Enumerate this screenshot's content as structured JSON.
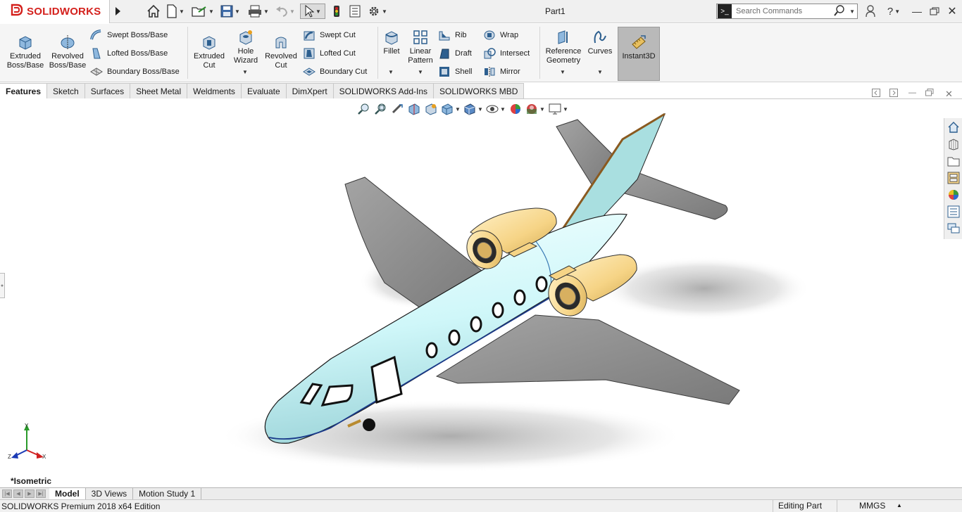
{
  "app": {
    "brand_prefix": "3DS",
    "brand_name": "SOLIDWORKS",
    "document_title": "Part1"
  },
  "search": {
    "placeholder": "Search Commands"
  },
  "quick_access": [
    "home-icon",
    "new-icon",
    "open-icon",
    "save-icon",
    "print-icon",
    "undo-icon",
    "select-icon",
    "rebuild-icon",
    "file-properties-icon",
    "options-icon"
  ],
  "ribbon": {
    "extruded_boss": "Extruded\nBoss/Base",
    "revolved_boss": "Revolved\nBoss/Base",
    "swept_boss": "Swept Boss/Base",
    "lofted_boss": "Lofted Boss/Base",
    "boundary_boss": "Boundary Boss/Base",
    "extruded_cut": "Extruded\nCut",
    "hole_wizard": "Hole\nWizard",
    "revolved_cut": "Revolved\nCut",
    "swept_cut": "Swept Cut",
    "lofted_cut": "Lofted Cut",
    "boundary_cut": "Boundary Cut",
    "fillet": "Fillet",
    "linear_pattern": "Linear\nPattern",
    "rib": "Rib",
    "draft": "Draft",
    "shell": "Shell",
    "wrap": "Wrap",
    "intersect": "Intersect",
    "mirror": "Mirror",
    "reference_geometry": "Reference\nGeometry",
    "curves": "Curves",
    "instant3d": "Instant3D"
  },
  "command_tabs": [
    "Features",
    "Sketch",
    "Surfaces",
    "Sheet Metal",
    "Weldments",
    "Evaluate",
    "DimXpert",
    "SOLIDWORKS Add-Ins",
    "SOLIDWORKS MBD"
  ],
  "active_command_tab": "Features",
  "viewport": {
    "view_label": "*Isometric",
    "triad_x": "X",
    "triad_y": "Y",
    "triad_z": "Z"
  },
  "bottom_tabs": [
    "Model",
    "3D Views",
    "Motion Study 1"
  ],
  "status": {
    "edition": "SOLIDWORKS Premium 2018 x64 Edition",
    "mode": "Editing Part",
    "units": "MMGS"
  },
  "colors": {
    "brand_red": "#d4211d",
    "fuselage": "#cff7f9",
    "wing": "#8c8c8c",
    "engine": "#f6d486",
    "tail_fin": "#a9dfe0"
  }
}
